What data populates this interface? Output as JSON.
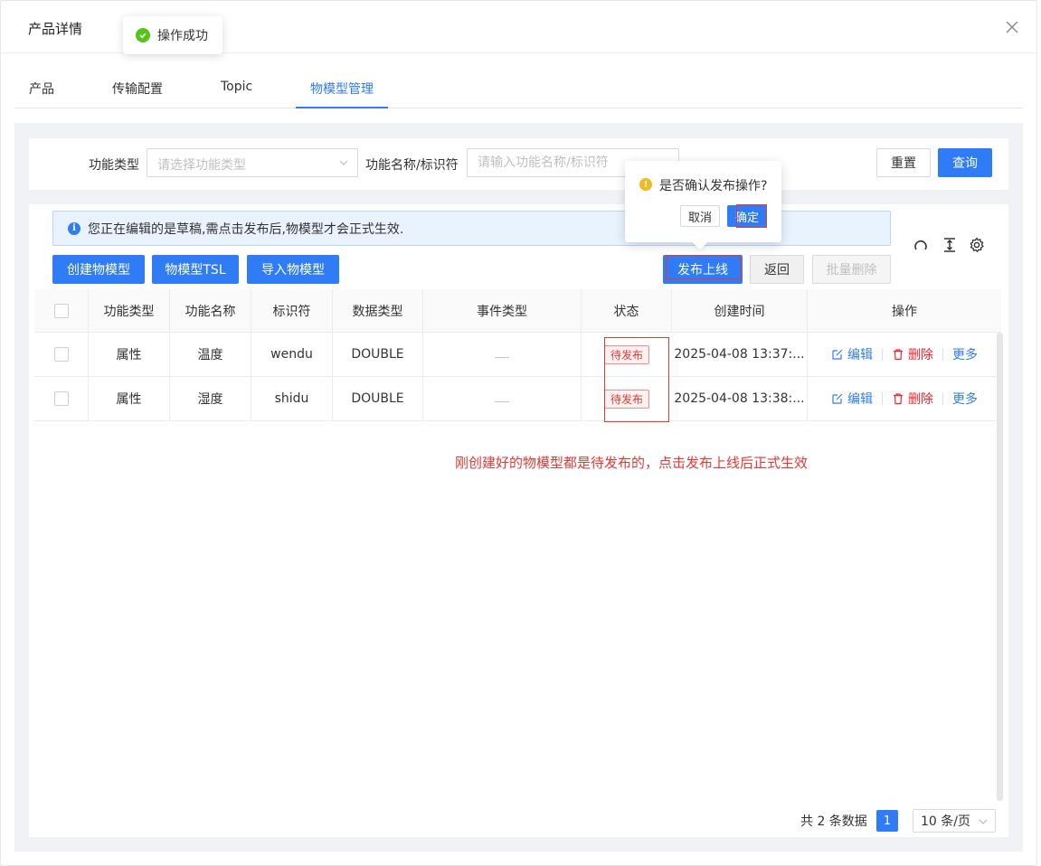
{
  "dialog": {
    "title": "产品详情"
  },
  "toast": {
    "text": "操作成功"
  },
  "tabs": [
    {
      "label": "产品"
    },
    {
      "label": "传输配置"
    },
    {
      "label": "Topic"
    },
    {
      "label": "物模型管理"
    }
  ],
  "search": {
    "type_label": "功能类型",
    "type_placeholder": "请选择功能类型",
    "name_label": "功能名称/标识符",
    "name_placeholder": "请输入功能名称/标识符",
    "reset_label": "重置",
    "query_label": "查询"
  },
  "alert": {
    "text": "您正在编辑的是草稿,需点击发布后,物模型才会正式生效."
  },
  "toolbar": {
    "create_label": "创建物模型",
    "tsl_label": "物模型TSL",
    "import_label": "导入物模型",
    "publish_label": "发布上线",
    "back_label": "返回",
    "batch_delete_label": "批量删除"
  },
  "popconfirm": {
    "text": "是否确认发布操作?",
    "cancel_label": "取消",
    "ok_label": "确定"
  },
  "table": {
    "headers": [
      "功能类型",
      "功能名称",
      "标识符",
      "数据类型",
      "事件类型",
      "状态",
      "创建时间",
      "操作"
    ],
    "rows": [
      {
        "type": "属性",
        "name": "温度",
        "identifier": "wendu",
        "data_type": "DOUBLE",
        "event_type": "",
        "status": "待发布",
        "created": "2025-04-08 13:37:...",
        "edit": "编辑",
        "delete": "删除",
        "more": "更多"
      },
      {
        "type": "属性",
        "name": "湿度",
        "identifier": "shidu",
        "data_type": "DOUBLE",
        "event_type": "",
        "status": "待发布",
        "created": "2025-04-08 13:38:...",
        "edit": "编辑",
        "delete": "删除",
        "more": "更多"
      }
    ]
  },
  "annotation": {
    "note": "刚创建好的物模型都是待发布的，点击发布上线后正式生效"
  },
  "pagination": {
    "total_text": "共 2 条数据",
    "current_page": "1",
    "page_size": "10 条/页"
  },
  "colors": {
    "primary": "#2f7cf6",
    "danger": "#e53935",
    "success": "#52c41a",
    "warning": "#f5b720"
  }
}
